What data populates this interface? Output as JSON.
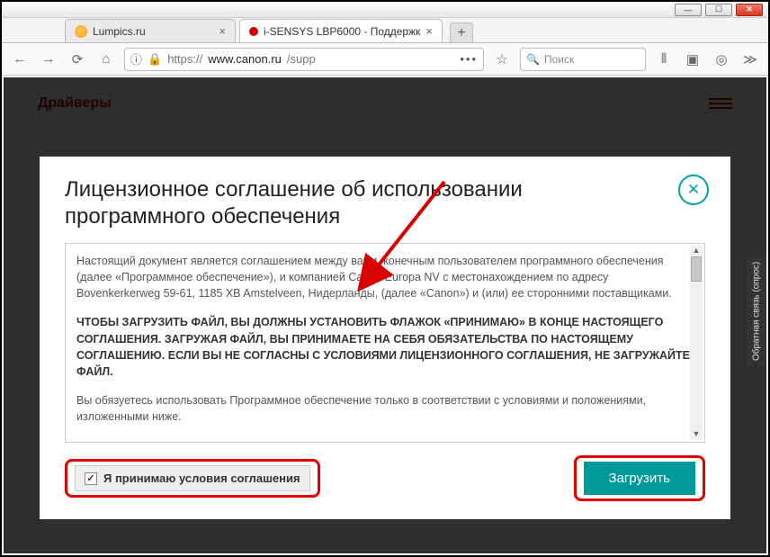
{
  "tabs": [
    {
      "title": "Lumpics.ru"
    },
    {
      "title": "i-SENSYS LBP6000 - Поддержк"
    }
  ],
  "url": {
    "protocol": "https://",
    "host": "www.canon.ru",
    "path": "/supp"
  },
  "search": {
    "placeholder": "Поиск"
  },
  "page": {
    "header": "Драйверы",
    "sidetab": "Обратная связь (опрос)"
  },
  "modal": {
    "title": "Лицензионное соглашение об использовании программного обеспечения",
    "p1": "Настоящий документ является соглашением между вами, конечным пользователем программного обеспечения (далее «Программное обеспечение»), и компанией Canon Europa NV с местонахождением по адресу Bovenkerkerweg 59-61, 1185 XB Amstelveen, Нидерланды, (далее «Canon») и (или) ее сторонними поставщиками.",
    "p2": "ЧТОБЫ ЗАГРУЗИТЬ ФАЙЛ, ВЫ ДОЛЖНЫ УСТАНОВИТЬ ФЛАЖОК «ПРИНИМАЮ» В КОНЦЕ НАСТОЯЩЕГО СОГЛАШЕНИЯ. ЗАГРУЖАЯ ФАЙЛ, ВЫ ПРИНИМАЕТЕ НА СЕБЯ ОБЯЗАТЕЛЬСТВА ПО НАСТОЯЩЕМУ СОГЛАШЕНИЮ. ЕСЛИ ВЫ НЕ СОГЛАСНЫ С УСЛОВИЯМИ ЛИЦЕНЗИОННОГО СОГЛАШЕНИЯ, НЕ ЗАГРУЖАЙТЕ ФАЙЛ.",
    "p3": "Вы обязуетесь использовать Программное обеспечение только в соответствии с условиями и положениями, изложенными ниже.",
    "accept_label": "Я принимаю условия соглашения",
    "download_label": "Загрузить"
  }
}
